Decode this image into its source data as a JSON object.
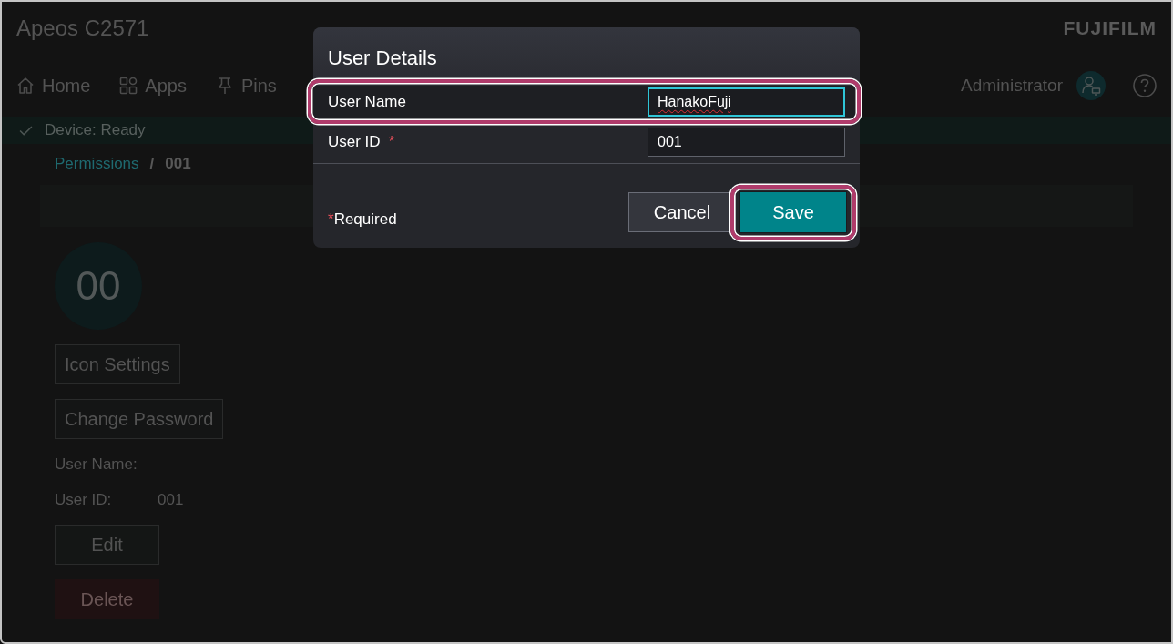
{
  "header": {
    "title": "Apeos C2571",
    "logo": "FUJIFILM"
  },
  "nav": {
    "items": [
      {
        "label": "Home"
      },
      {
        "label": "Apps"
      },
      {
        "label": "Pins"
      }
    ],
    "user": "Administrator"
  },
  "status_bar": {
    "text": "Device: Ready"
  },
  "breadcrumb": {
    "items": [
      {
        "label": "Permissions",
        "kind": "link"
      },
      {
        "label": "001",
        "kind": "current"
      }
    ],
    "separator": "/"
  },
  "profile": {
    "avatar_text": "00",
    "buttons": [
      "Icon Settings",
      "Change Password"
    ],
    "fields": [
      {
        "label": "User Name:"
      },
      {
        "label": "User ID:",
        "value": "001"
      }
    ],
    "actions": [
      {
        "label": "Edit",
        "kind": "secondary"
      },
      {
        "label": "Delete",
        "kind": "danger"
      }
    ]
  },
  "dialog": {
    "title": "User Details",
    "fields": [
      {
        "label": "User Name",
        "value": "HanakoFuji",
        "focused": true,
        "spelling_error": true,
        "highlighted": true
      },
      {
        "label": "User ID",
        "required_mark": "*",
        "value": "001",
        "focused": false,
        "spelling_error": false,
        "highlighted": false
      }
    ],
    "required_note": {
      "mark": "*",
      "text": "Required"
    },
    "buttons": [
      {
        "label": "Cancel",
        "kind": "secondary",
        "highlighted": false
      },
      {
        "label": "Save",
        "kind": "primary",
        "highlighted": true
      }
    ]
  }
}
